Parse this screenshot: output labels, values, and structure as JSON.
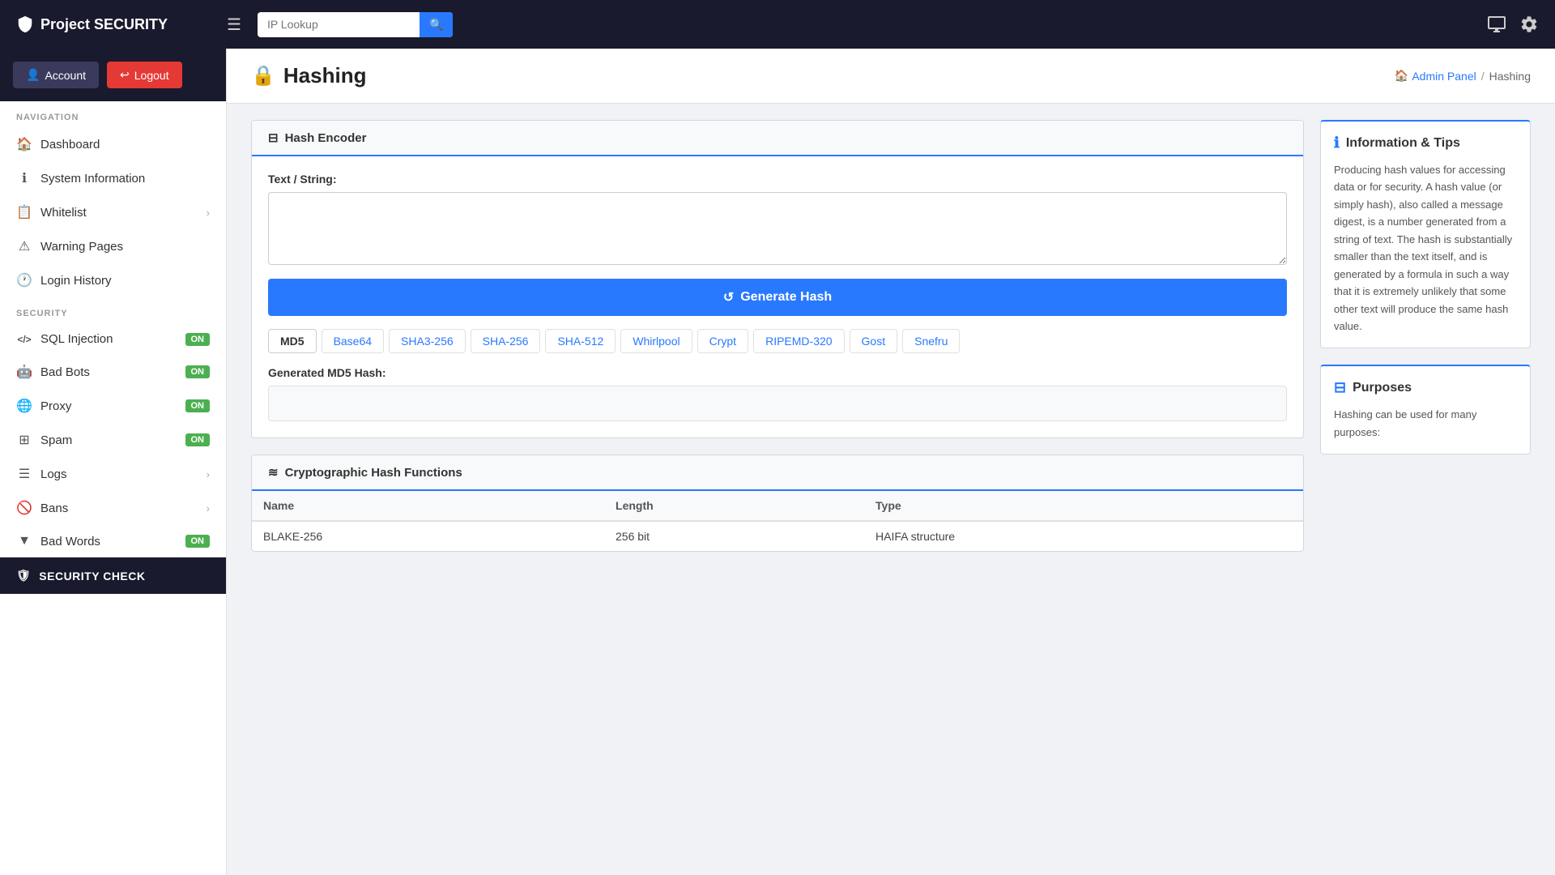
{
  "topbar": {
    "brand": "Project SECURITY",
    "search_placeholder": "IP Lookup",
    "search_button_label": "🔍"
  },
  "sidebar": {
    "account_label": "Account",
    "logout_label": "Logout",
    "nav_section": "NAVIGATION",
    "nav_items": [
      {
        "id": "dashboard",
        "icon": "🏠",
        "label": "Dashboard",
        "has_chevron": false
      },
      {
        "id": "system-information",
        "icon": "ℹ️",
        "label": "System Information",
        "has_chevron": false
      },
      {
        "id": "whitelist",
        "icon": "📋",
        "label": "Whitelist",
        "has_chevron": true
      },
      {
        "id": "warning-pages",
        "icon": "⚠️",
        "label": "Warning Pages",
        "has_chevron": false
      },
      {
        "id": "login-history",
        "icon": "🕐",
        "label": "Login History",
        "has_chevron": false
      }
    ],
    "security_section": "SECURITY",
    "security_items": [
      {
        "id": "sql-injection",
        "icon": "</>",
        "label": "SQL Injection",
        "badge": "ON"
      },
      {
        "id": "bad-bots",
        "icon": "🤖",
        "label": "Bad Bots",
        "badge": "ON"
      },
      {
        "id": "proxy",
        "icon": "🌐",
        "label": "Proxy",
        "badge": "ON"
      },
      {
        "id": "spam",
        "icon": "⊞",
        "label": "Spam",
        "badge": "ON"
      },
      {
        "id": "logs",
        "icon": "☰",
        "label": "Logs",
        "has_chevron": true
      },
      {
        "id": "bans",
        "icon": "🚫",
        "label": "Bans",
        "has_chevron": true
      },
      {
        "id": "bad-words",
        "icon": "▼",
        "label": "Bad Words",
        "badge": "ON"
      }
    ],
    "security_check_label": "SECURITY CHECK"
  },
  "page": {
    "title": "Hashing",
    "breadcrumb_home": "Admin Panel",
    "breadcrumb_current": "Hashing"
  },
  "hash_encoder": {
    "card_title": "Hash Encoder",
    "text_label": "Text / String:",
    "text_placeholder": "",
    "generate_label": "Generate Hash",
    "tabs": [
      {
        "id": "md5",
        "label": "MD5",
        "active": true
      },
      {
        "id": "base64",
        "label": "Base64"
      },
      {
        "id": "sha3-256",
        "label": "SHA3-256"
      },
      {
        "id": "sha-256",
        "label": "SHA-256"
      },
      {
        "id": "sha-512",
        "label": "SHA-512"
      },
      {
        "id": "whirlpool",
        "label": "Whirlpool"
      },
      {
        "id": "crypt",
        "label": "Crypt"
      },
      {
        "id": "ripemd-320",
        "label": "RIPEMD-320"
      },
      {
        "id": "gost",
        "label": "Gost"
      },
      {
        "id": "snefru",
        "label": "Snefru"
      }
    ],
    "result_label": "Generated MD5 Hash:",
    "result_value": ""
  },
  "hash_functions": {
    "card_title": "Cryptographic Hash Functions",
    "columns": [
      "Name",
      "Length",
      "Type"
    ],
    "rows": [
      {
        "name": "BLAKE-256",
        "length": "256 bit",
        "type": "HAIFA structure"
      }
    ]
  },
  "info_tips": {
    "title": "Information & Tips",
    "text": "Producing hash values for accessing data or for security. A hash value (or simply hash), also called a message digest, is a number generated from a string of text. The hash is substantially smaller than the text itself, and is generated by a formula in such a way that it is extremely unlikely that some other text will produce the same hash value."
  },
  "purposes": {
    "title": "Purposes",
    "text": "Hashing can be used for many purposes:"
  }
}
